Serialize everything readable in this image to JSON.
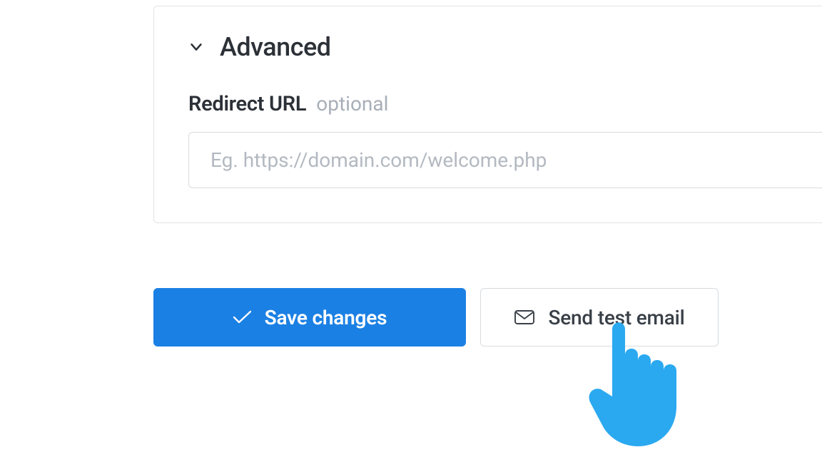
{
  "panel": {
    "section_title": "Advanced",
    "redirect_url": {
      "label": "Redirect URL",
      "optional_tag": "optional",
      "placeholder": "Eg. https://domain.com/welcome.php",
      "value": ""
    }
  },
  "buttons": {
    "save_label": "Save changes",
    "send_test_label": "Send test email"
  },
  "colors": {
    "primary": "#1b80e4",
    "cursor": "#2aa9f0"
  }
}
